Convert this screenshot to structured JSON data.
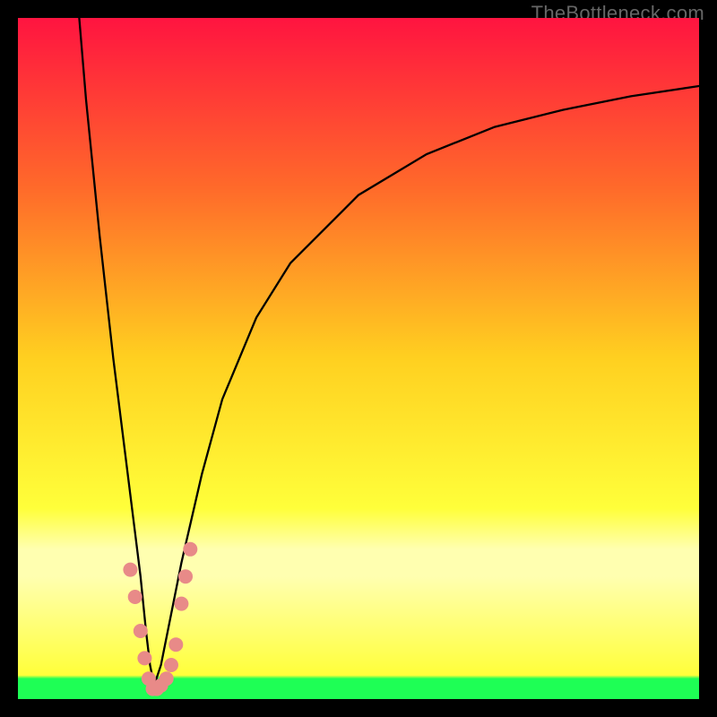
{
  "watermark": "TheBottleneck.com",
  "colors": {
    "frame": "#000000",
    "top": "#ff1440",
    "mid_upper": "#ff6a2a",
    "mid": "#ffd020",
    "mid_lower": "#ffff3a",
    "pale_band": "#ffffb0",
    "bottom": "#1eff55",
    "curve": "#000000",
    "markers": "#e88a88"
  },
  "chart_data": {
    "type": "line",
    "title": "",
    "xlabel": "",
    "ylabel": "",
    "xlim": [
      0,
      100
    ],
    "ylim": [
      0,
      100
    ],
    "series": [
      {
        "name": "bottleneck-curve",
        "x": [
          9,
          10,
          12,
          14,
          16,
          17,
          18,
          18.8,
          19.4,
          20,
          21,
          22,
          24,
          27,
          30,
          35,
          40,
          50,
          60,
          70,
          80,
          90,
          100
        ],
        "values": [
          100,
          88,
          68,
          50,
          34,
          26,
          18,
          10,
          5,
          2,
          5,
          10,
          20,
          33,
          44,
          56,
          64,
          74,
          80,
          84,
          86.5,
          88.5,
          90
        ]
      }
    ],
    "markers": {
      "name": "highlighted-points",
      "x": [
        16.5,
        17.2,
        18.0,
        18.6,
        19.2,
        19.8,
        20.4,
        21.0,
        21.8,
        22.5,
        23.2,
        24.0,
        24.6,
        25.3
      ],
      "values": [
        19,
        15,
        10,
        6,
        3,
        1.5,
        1.5,
        2,
        3,
        5,
        8,
        14,
        18,
        22
      ]
    }
  }
}
